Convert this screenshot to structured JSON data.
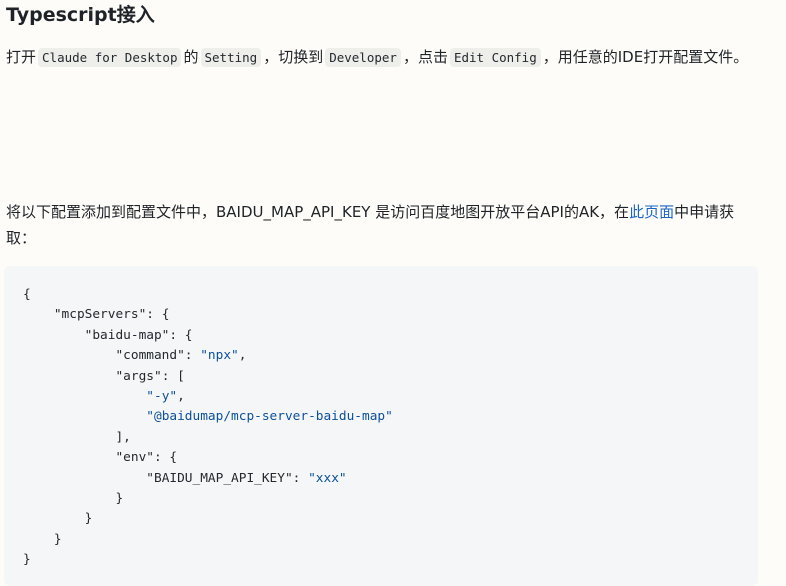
{
  "heading": "Typescript接入",
  "para1": {
    "t1": "打开",
    "c1": "Claude for Desktop",
    "t2": "的",
    "c2": "Setting",
    "t3": "，切换到",
    "c3": "Developer",
    "t4": "，点击",
    "c4": "Edit Config",
    "t5": "，用任意的IDE打开配置文件。"
  },
  "para2": {
    "text_before": "将以下配置添加到配置文件中，BAIDU_MAP_API_KEY 是访问百度地图开放平台API的AK，在",
    "link": "此页面",
    "text_after": "中申请获取："
  },
  "code": {
    "lines": [
      {
        "indent": 0,
        "parts": [
          {
            "t": "p",
            "v": "{"
          }
        ]
      },
      {
        "indent": 1,
        "parts": [
          {
            "t": "k",
            "v": "\"mcpServers\""
          },
          {
            "t": "p",
            "v": ": {"
          }
        ]
      },
      {
        "indent": 2,
        "parts": [
          {
            "t": "k",
            "v": "\"baidu-map\""
          },
          {
            "t": "p",
            "v": ": {"
          }
        ]
      },
      {
        "indent": 3,
        "parts": [
          {
            "t": "k",
            "v": "\"command\""
          },
          {
            "t": "p",
            "v": ": "
          },
          {
            "t": "s",
            "v": "\"npx\""
          },
          {
            "t": "p",
            "v": ","
          }
        ]
      },
      {
        "indent": 3,
        "parts": [
          {
            "t": "k",
            "v": "\"args\""
          },
          {
            "t": "p",
            "v": ": ["
          }
        ]
      },
      {
        "indent": 4,
        "parts": [
          {
            "t": "s",
            "v": "\"-y\""
          },
          {
            "t": "p",
            "v": ","
          }
        ]
      },
      {
        "indent": 4,
        "parts": [
          {
            "t": "s",
            "v": "\"@baidumap/mcp-server-baidu-map\""
          }
        ]
      },
      {
        "indent": 3,
        "parts": [
          {
            "t": "p",
            "v": "],"
          }
        ]
      },
      {
        "indent": 3,
        "parts": [
          {
            "t": "k",
            "v": "\"env\""
          },
          {
            "t": "p",
            "v": ": {"
          }
        ]
      },
      {
        "indent": 4,
        "parts": [
          {
            "t": "k",
            "v": "\"BAIDU_MAP_API_KEY\""
          },
          {
            "t": "p",
            "v": ": "
          },
          {
            "t": "s",
            "v": "\"xxx\""
          }
        ]
      },
      {
        "indent": 3,
        "parts": [
          {
            "t": "p",
            "v": "}"
          }
        ]
      },
      {
        "indent": 2,
        "parts": [
          {
            "t": "p",
            "v": "}"
          }
        ]
      },
      {
        "indent": 1,
        "parts": [
          {
            "t": "p",
            "v": "}"
          }
        ]
      },
      {
        "indent": 0,
        "parts": [
          {
            "t": "p",
            "v": "}"
          }
        ]
      }
    ]
  },
  "colors": {
    "link": "#1a66c6",
    "string": "#0b4f9c",
    "code_bg": "#f5f6f7",
    "inline_code_bg": "#eeeeea"
  }
}
